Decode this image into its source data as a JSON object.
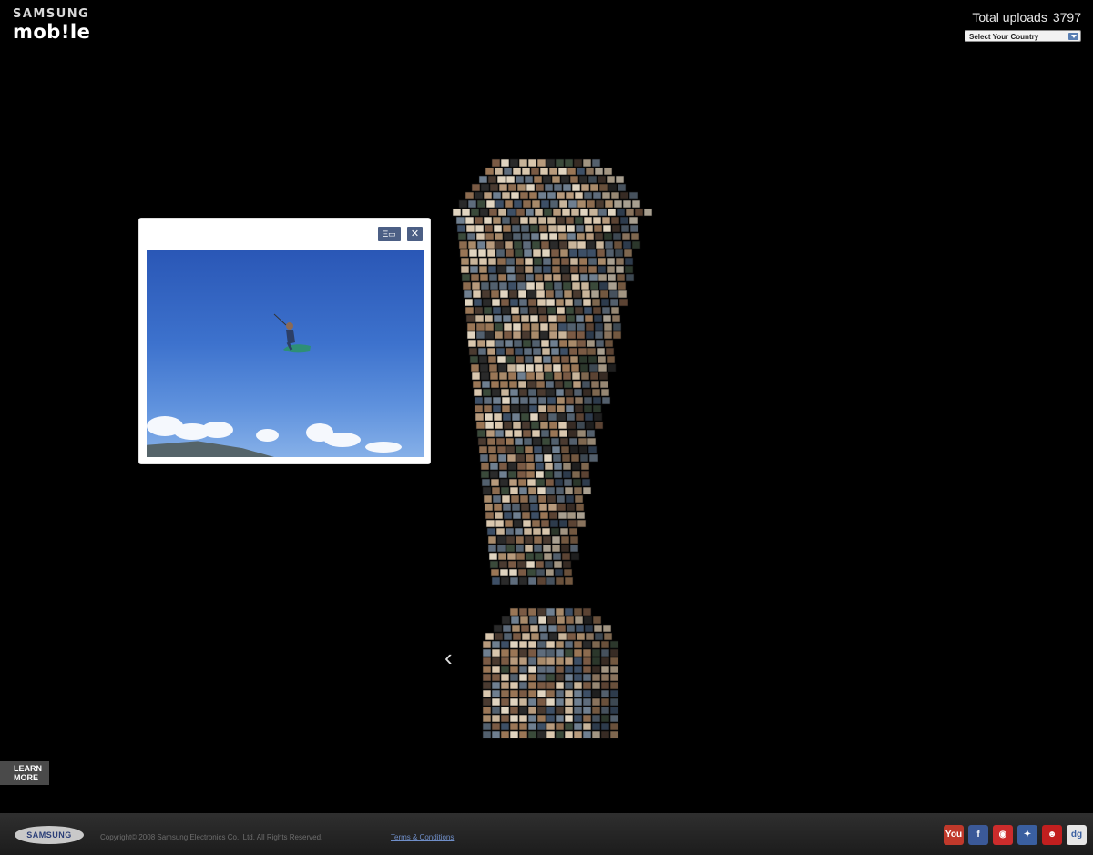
{
  "header": {
    "brand": "SAMSUNG",
    "product": "mob!le",
    "uploads_label": "Total uploads",
    "uploads_count": "3797",
    "country_select": "Select Your Country"
  },
  "popup": {
    "minimize_label": "Ξ▭",
    "close_label": "✕"
  },
  "learn_more": {
    "line1": "LEARN",
    "line2": "MORE"
  },
  "footer": {
    "logo_text": "SAMSUNG",
    "copyright": "Copyright© 2008 Samsung Electronics Co., Ltd. All Rights Reserved.",
    "terms": "Terms & Conditions"
  },
  "social_links": [
    {
      "icon": "youtube-icon",
      "glyph": "You",
      "color": "#c0392b"
    },
    {
      "icon": "facebook-icon",
      "glyph": "f",
      "color": "#3b5998"
    },
    {
      "icon": "flickr-icon",
      "glyph": "◉",
      "color": "#cc2c2c"
    },
    {
      "icon": "myspace-icon",
      "glyph": "✦",
      "color": "#3a5fa0"
    },
    {
      "icon": "bebo-icon",
      "glyph": "☻",
      "color": "#c21f1f"
    },
    {
      "icon": "digg-icon",
      "glyph": "dg",
      "color": "#e7e7e7"
    }
  ],
  "colors": {
    "background": "#000000",
    "popup_button": "#4c5f85",
    "footer": "#262626",
    "terms_link": "#6f8ec8"
  }
}
